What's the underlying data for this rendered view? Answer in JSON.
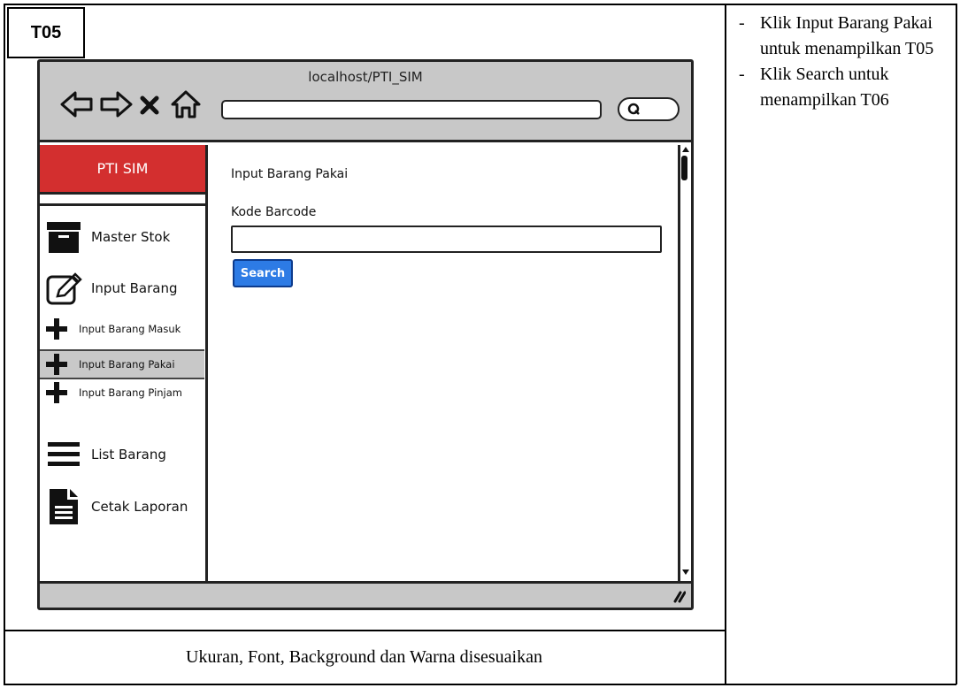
{
  "screen_code": "T05",
  "browser": {
    "title": "localhost/PTI_SIM",
    "address_value": "",
    "search_value": ""
  },
  "sidebar": {
    "brand": "PTI SIM",
    "brand_color": "#d32f2f",
    "items": [
      {
        "label": "Master Stok",
        "icon": "archive-box-icon"
      },
      {
        "label": "Input Barang",
        "icon": "edit-pencil-icon"
      },
      {
        "label": "Input Barang Masuk",
        "icon": "plus-icon"
      },
      {
        "label": "Input Barang Pakai",
        "icon": "plus-icon",
        "active": true
      },
      {
        "label": "Input Barang Pinjam",
        "icon": "plus-icon"
      },
      {
        "label": "List Barang",
        "icon": "hamburger-list-icon"
      },
      {
        "label": "Cetak Laporan",
        "icon": "document-icon"
      }
    ]
  },
  "main": {
    "heading": "Input Barang Pakai",
    "field_label": "Kode Barcode",
    "field_value": "",
    "search_button": "Search",
    "button_color": "#2d7be5"
  },
  "notes": [
    "Klik Input Barang Pakai untuk menampilkan T05",
    "Klik Search untuk menampilkan T06"
  ],
  "caption": "Ukuran, Font, Background dan Warna disesuaikan"
}
